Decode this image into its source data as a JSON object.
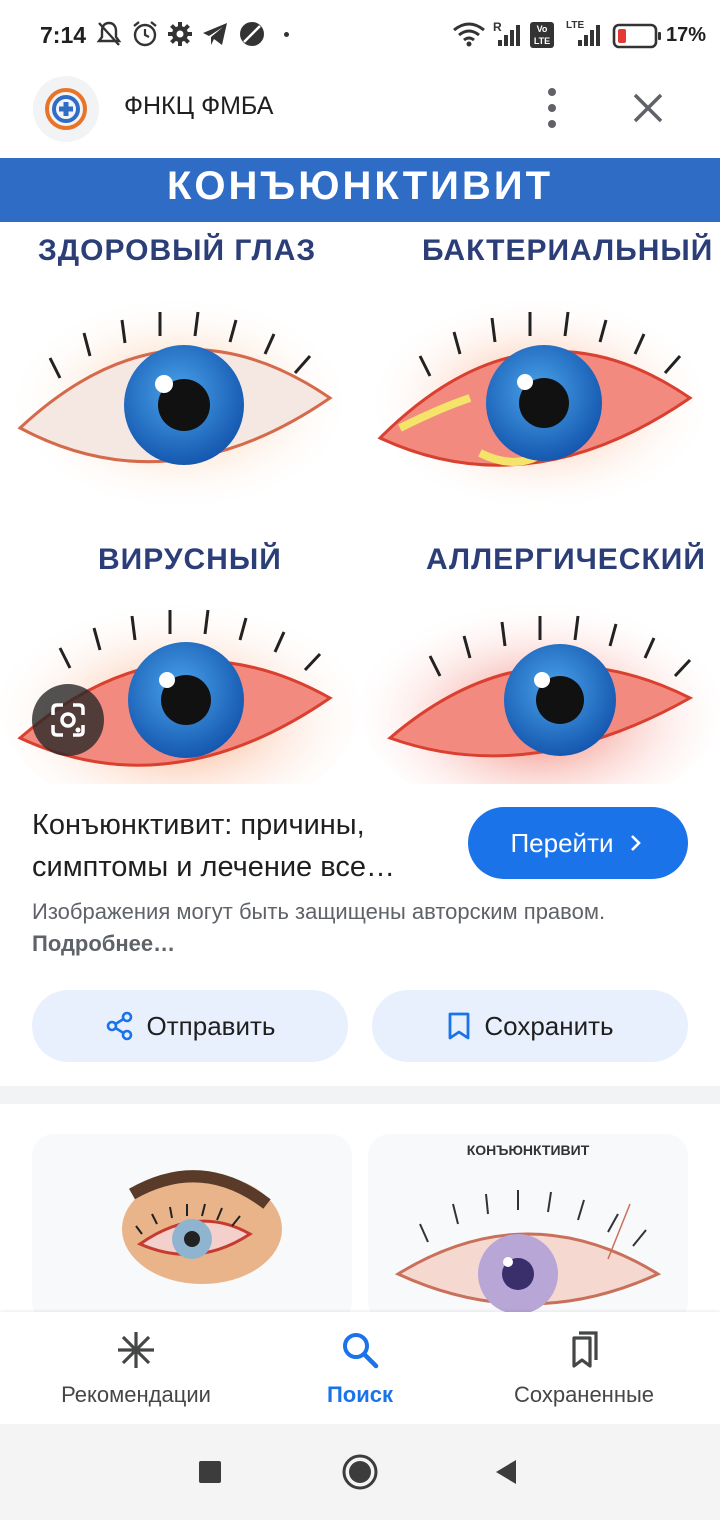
{
  "status_bar": {
    "time": "7:14",
    "battery_percent": "17%",
    "network_r": "R",
    "volte": "Vo LTE",
    "lte": "LTE",
    "battery_low_color": "#e53935"
  },
  "header": {
    "site_name": "ФНКЦ ФМБА"
  },
  "image": {
    "banner": "КОНЪЮНКТИВИТ",
    "labels": [
      "ЗДОРОВЫЙ ГЛАЗ",
      "БАКТЕРИАЛЬНЫЙ",
      "ВИРУСНЫЙ",
      "АЛЛЕРГИЧЕСКИЙ"
    ]
  },
  "result": {
    "title": "Конъюнктивит: причины, симптомы и лечение все…",
    "visit_label": "Перейти",
    "copyright_text": "Изображения могут быть защищены авторским правом.",
    "copyright_more": "Подробнее…"
  },
  "actions": {
    "share_label": "Отправить",
    "save_label": "Сохранить"
  },
  "related": {
    "card2_caption": "КОНЪЮНКТИВИТ"
  },
  "bottom_nav": {
    "items": [
      {
        "label": "Рекомендации",
        "icon": "discover-icon"
      },
      {
        "label": "Поиск",
        "icon": "search-icon",
        "active": true
      },
      {
        "label": "Сохраненные",
        "icon": "saved-icon"
      }
    ]
  },
  "colors": {
    "accent": "#1a73e8",
    "banner": "#2f6cc6",
    "label": "#2b3e78",
    "chip_bg": "#e8f0fe"
  }
}
